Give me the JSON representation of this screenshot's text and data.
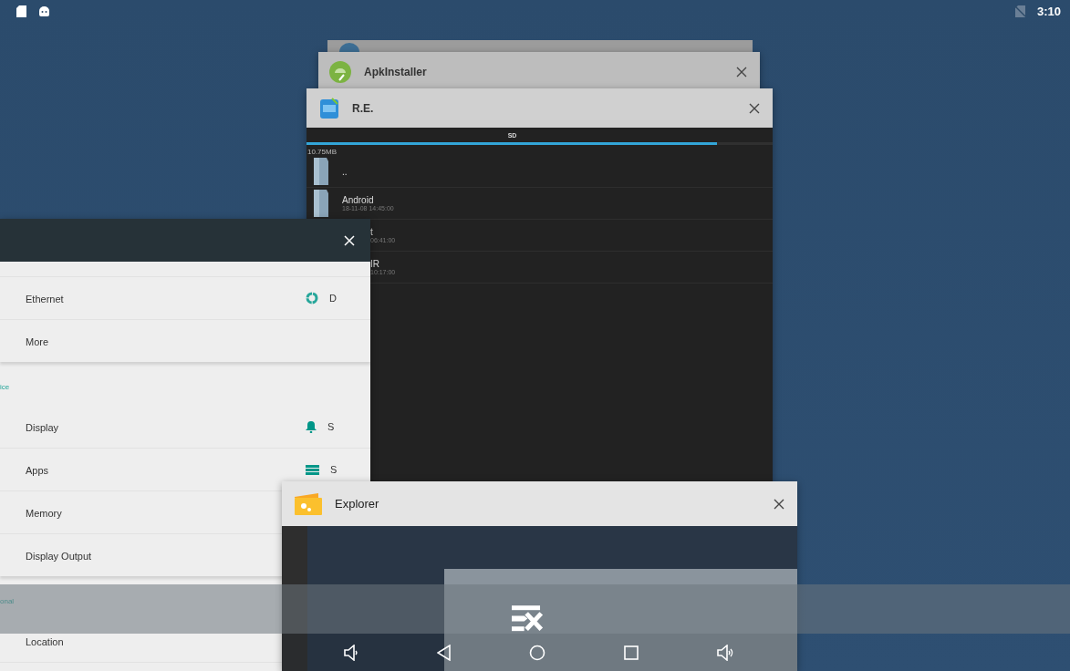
{
  "status_bar": {
    "time": "3:10"
  },
  "apk_installer": {
    "title": "ApkInstaller"
  },
  "re_explorer": {
    "title": "R.E.",
    "tab": "SD",
    "level": 0.88,
    "storage": "10.75MB",
    "rows": [
      {
        "name": "..",
        "covered": false
      },
      {
        "name": "Android",
        "date": "18-11-08 14:45:00",
        "covered": false
      },
      {
        "name": "t",
        "date": "06:41:00",
        "covered": true
      },
      {
        "name": "IR",
        "date": "10:17:00",
        "covered": true
      }
    ]
  },
  "settings": {
    "rows": [
      {
        "kind": "item",
        "label": "Ethernet",
        "side_text": "D"
      },
      {
        "kind": "item",
        "label": "More"
      },
      {
        "kind": "section",
        "label": "ice"
      },
      {
        "kind": "item",
        "label": "Display",
        "side_text": "S"
      },
      {
        "kind": "item",
        "label": "Apps",
        "side_text": "S"
      },
      {
        "kind": "item",
        "label": "Memory"
      },
      {
        "kind": "item",
        "label": "Display Output"
      },
      {
        "kind": "section",
        "label": "onal"
      },
      {
        "kind": "item",
        "label": "Location"
      }
    ]
  },
  "explorer": {
    "title": "Explorer"
  }
}
